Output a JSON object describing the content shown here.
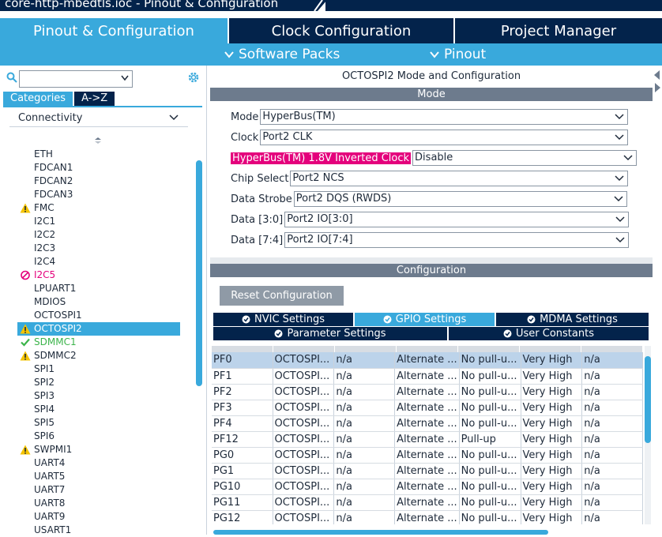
{
  "window": {
    "title": "core-http-mbedtls.ioc - Pinout & Configuration"
  },
  "main_tabs": [
    {
      "label": "Pinout & Configuration",
      "active": true
    },
    {
      "label": "Clock Configuration",
      "active": false
    },
    {
      "label": "Project Manager",
      "active": false
    }
  ],
  "sub_menu": {
    "software_packs": "Software Packs",
    "pinout": "Pinout"
  },
  "sidebar": {
    "search": {
      "value": "",
      "placeholder": ""
    },
    "tabs": {
      "categories": "Categories",
      "az": "A->Z"
    },
    "group": "Connectivity",
    "items": [
      {
        "label": "ETH",
        "status": "none"
      },
      {
        "label": "FDCAN1",
        "status": "none"
      },
      {
        "label": "FDCAN2",
        "status": "none"
      },
      {
        "label": "FDCAN3",
        "status": "none"
      },
      {
        "label": "FMC",
        "status": "warning"
      },
      {
        "label": "I2C1",
        "status": "none"
      },
      {
        "label": "I2C2",
        "status": "none"
      },
      {
        "label": "I2C3",
        "status": "none"
      },
      {
        "label": "I2C4",
        "status": "none"
      },
      {
        "label": "I2C5",
        "status": "disabled"
      },
      {
        "label": "LPUART1",
        "status": "none"
      },
      {
        "label": "MDIOS",
        "status": "none"
      },
      {
        "label": "OCTOSPI1",
        "status": "none"
      },
      {
        "label": "OCTOSPI2",
        "status": "warning",
        "selected": true
      },
      {
        "label": "SDMMC1",
        "status": "ok"
      },
      {
        "label": "SDMMC2",
        "status": "warning"
      },
      {
        "label": "SPI1",
        "status": "none"
      },
      {
        "label": "SPI2",
        "status": "none"
      },
      {
        "label": "SPI3",
        "status": "none"
      },
      {
        "label": "SPI4",
        "status": "none"
      },
      {
        "label": "SPI5",
        "status": "none"
      },
      {
        "label": "SPI6",
        "status": "none"
      },
      {
        "label": "SWPMI1",
        "status": "warning"
      },
      {
        "label": "UART4",
        "status": "none"
      },
      {
        "label": "UART5",
        "status": "none"
      },
      {
        "label": "UART7",
        "status": "none"
      },
      {
        "label": "UART8",
        "status": "none"
      },
      {
        "label": "UART9",
        "status": "none"
      },
      {
        "label": "USART1",
        "status": "none"
      }
    ]
  },
  "panel": {
    "title": "OCTOSPI2 Mode and Configuration",
    "mode_band": "Mode",
    "config_band": "Configuration",
    "mode_rows": [
      {
        "label": "Mode",
        "value": "HyperBus(TM)",
        "highlight": false
      },
      {
        "label": "Clock",
        "value": "Port2 CLK",
        "highlight": false
      },
      {
        "label": "HyperBus(TM) 1.8V Inverted Clock",
        "value": "Disable",
        "highlight": true
      },
      {
        "label": "Chip Select",
        "value": "Port2 NCS",
        "highlight": false
      },
      {
        "label": "Data Strobe",
        "value": "Port2 DQS (RWDS)",
        "highlight": false
      },
      {
        "label": "Data [3:0]",
        "value": "Port2 IO[3:0]",
        "highlight": false
      },
      {
        "label": "Data [7:4]",
        "value": "Port2 IO[7:4]",
        "highlight": false
      }
    ],
    "reset_button": "Reset Configuration",
    "settings_tabs_row1": [
      {
        "label": "NVIC Settings",
        "active": false
      },
      {
        "label": "GPIO Settings",
        "active": true
      },
      {
        "label": "MDMA Settings",
        "active": false
      }
    ],
    "settings_tabs_row2": [
      {
        "label": "Parameter Settings",
        "active": false
      },
      {
        "label": "User Constants",
        "active": false
      }
    ],
    "gpio_rows": [
      [
        "PF0",
        "OCTOSPI...",
        "n/a",
        "Alternate ...",
        "No pull-u...",
        "Very High",
        "n/a"
      ],
      [
        "PF1",
        "OCTOSPI...",
        "n/a",
        "Alternate ...",
        "No pull-u...",
        "Very High",
        "n/a"
      ],
      [
        "PF2",
        "OCTOSPI...",
        "n/a",
        "Alternate ...",
        "No pull-u...",
        "Very High",
        "n/a"
      ],
      [
        "PF3",
        "OCTOSPI...",
        "n/a",
        "Alternate ...",
        "No pull-u...",
        "Very High",
        "n/a"
      ],
      [
        "PF4",
        "OCTOSPI...",
        "n/a",
        "Alternate ...",
        "No pull-u...",
        "Very High",
        "n/a"
      ],
      [
        "PF12",
        "OCTOSPI...",
        "n/a",
        "Alternate ...",
        "Pull-up",
        "Very High",
        "n/a"
      ],
      [
        "PG0",
        "OCTOSPI...",
        "n/a",
        "Alternate ...",
        "No pull-u...",
        "Very High",
        "n/a"
      ],
      [
        "PG1",
        "OCTOSPI...",
        "n/a",
        "Alternate ...",
        "No pull-u...",
        "Very High",
        "n/a"
      ],
      [
        "PG10",
        "OCTOSPI...",
        "n/a",
        "Alternate ...",
        "No pull-u...",
        "Very High",
        "n/a"
      ],
      [
        "PG11",
        "OCTOSPI...",
        "n/a",
        "Alternate ...",
        "No pull-u...",
        "Very High",
        "n/a"
      ],
      [
        "PG12",
        "OCTOSPI...",
        "n/a",
        "Alternate ...",
        "No pull-u...",
        "Very High",
        "n/a"
      ]
    ]
  },
  "colors": {
    "navy": "#03234b",
    "accent": "#39a9dc",
    "band": "#6d7b8d",
    "highlight": "#e4007c",
    "warning": "#f5c400",
    "ok": "#3cb44b"
  }
}
